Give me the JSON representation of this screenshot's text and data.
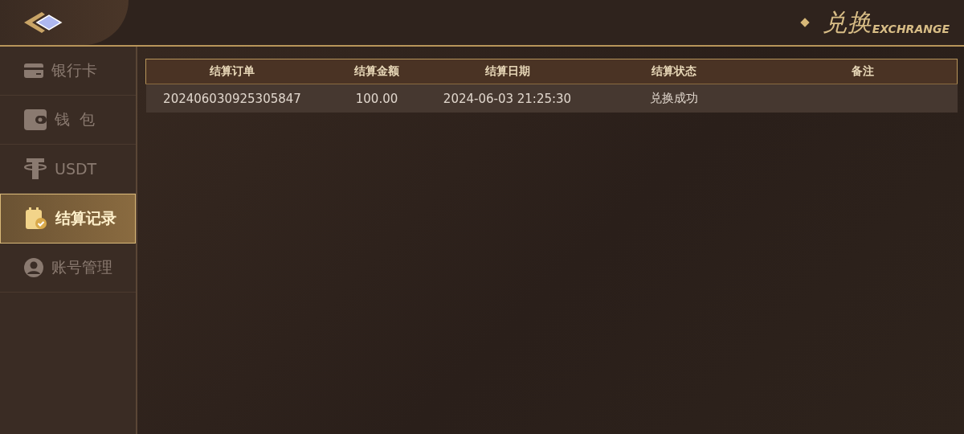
{
  "header": {
    "title": "兑换",
    "subtitle": "EXCHRANGE"
  },
  "sidebar": {
    "items": [
      {
        "kind": "card",
        "label": "银行卡",
        "selected": false
      },
      {
        "kind": "wallet",
        "label": "钱  包",
        "selected": false
      },
      {
        "kind": "tether",
        "label": "USDT",
        "selected": false
      },
      {
        "kind": "record",
        "label": "结算记录",
        "selected": true
      },
      {
        "kind": "user",
        "label": "账号管理",
        "selected": false
      }
    ]
  },
  "table": {
    "columns": [
      "结算订单",
      "结算金额",
      "结算日期",
      "结算状态",
      "备注"
    ],
    "rows": [
      [
        "202406030925305847",
        "100.00",
        "2024-06-03 21:25:30",
        "兑换成功",
        ""
      ]
    ]
  }
}
